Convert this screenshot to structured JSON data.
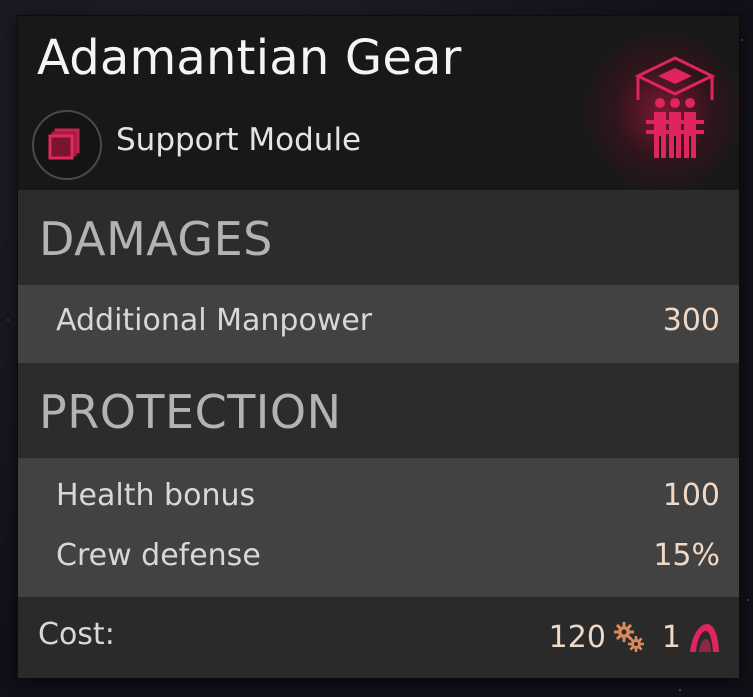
{
  "item": {
    "name": "Adamantian Gear",
    "type_label": "Support Module",
    "type_icon": "support-module-icon",
    "module_icon": "adamantian-gear-icon",
    "accent_color": "#e0245e"
  },
  "sections": {
    "damages": {
      "title": "DAMAGES",
      "stats": [
        {
          "name": "Additional Manpower",
          "value": "300"
        }
      ]
    },
    "protection": {
      "title": "PROTECTION",
      "stats": [
        {
          "name": "Health bonus",
          "value": "100"
        },
        {
          "name": "Crew defense",
          "value": "15%"
        }
      ]
    }
  },
  "cost": {
    "label": "Cost:",
    "resource_amount": "120",
    "resource_icon": "gear-resource-icon",
    "crew_amount": "1",
    "crew_icon": "crew-arch-icon"
  }
}
